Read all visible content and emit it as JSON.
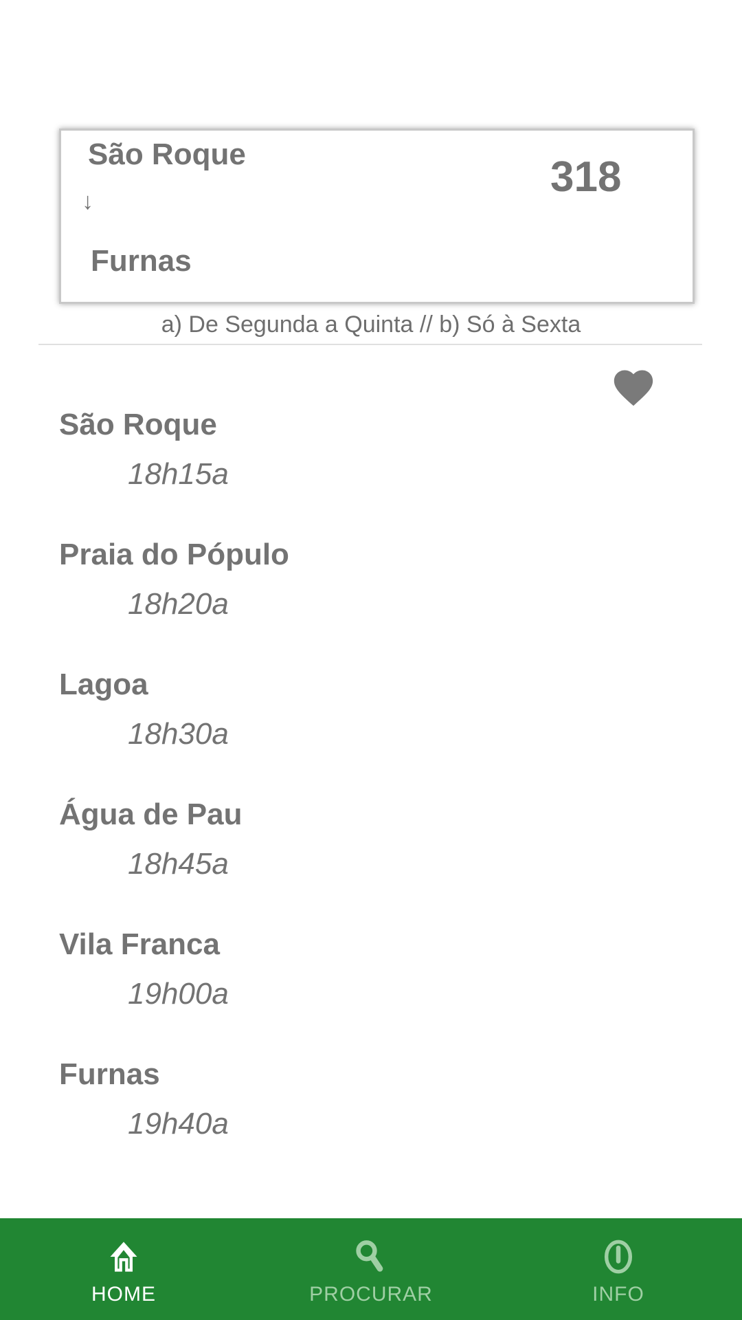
{
  "route_card": {
    "from": "São Roque",
    "arrow": "↓",
    "to": "Furnas",
    "route_number": "318"
  },
  "caption": "a) De Segunda a Quinta // b) Só à Sexta",
  "favorite_icon": "heart-icon",
  "stops": [
    {
      "name": "São Roque",
      "time": "18h15a"
    },
    {
      "name": "Praia do Pópulo",
      "time": "18h20a"
    },
    {
      "name": "Lagoa",
      "time": "18h30a"
    },
    {
      "name": "Água de Pau",
      "time": "18h45a"
    },
    {
      "name": "Vila Franca",
      "time": "19h00a"
    },
    {
      "name": "Furnas",
      "time": "19h40a"
    }
  ],
  "nav": {
    "color": "#218633",
    "items": [
      {
        "label": "HOME",
        "icon": "home-icon",
        "active": true
      },
      {
        "label": "PROCURAR",
        "icon": "search-icon",
        "active": false
      },
      {
        "label": "INFO",
        "icon": "info-icon",
        "active": false
      }
    ]
  }
}
